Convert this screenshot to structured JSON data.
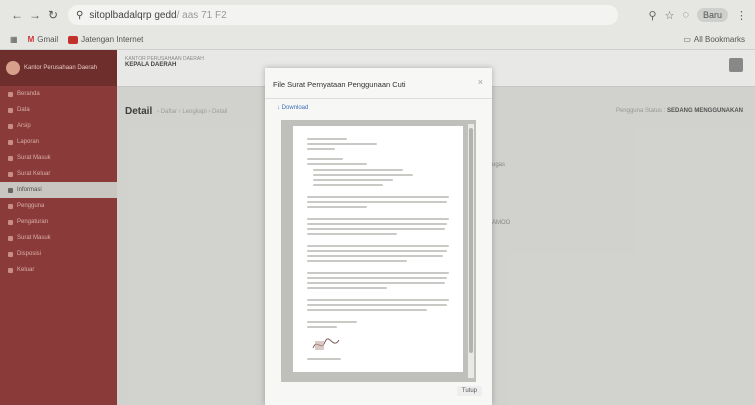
{
  "browser": {
    "url_host": "sitoplbadalqrp gedd",
    "url_rest": "/ aas 71 F2",
    "bookmarks": [
      {
        "label": "Gmail"
      },
      {
        "label": "Jatengan Internet"
      }
    ],
    "right_bookmark": "All Bookmarks",
    "profile_label": "Baru"
  },
  "sidebar": {
    "title": "Kantor Perusahaan Daerah",
    "items": [
      {
        "label": "Beranda"
      },
      {
        "label": "Data"
      },
      {
        "label": "Arsip"
      },
      {
        "label": "Laporan"
      },
      {
        "label": "Surat Masuk"
      },
      {
        "label": "Surat Keluar"
      },
      {
        "label": "Informasi"
      },
      {
        "label": "Pengguna"
      },
      {
        "label": "Pengaturan"
      },
      {
        "label": "Surat Masuk"
      },
      {
        "label": "Disposisi"
      },
      {
        "label": "Keluar"
      }
    ]
  },
  "header": {
    "org_line": "KANTOR PERUSAHAAN DAERAH",
    "org_name": "KEPALA DAERAH"
  },
  "main": {
    "title": "Detail",
    "breadcrumbs": "› Daftar  › Lengkapi  › Detail",
    "right_label_prefix": "Pengguna Status :",
    "right_label_value": "SEDANG MENGGUNAKAN",
    "bg_text_1": "ugas",
    "bg_text_2": "AMOO"
  },
  "modal": {
    "title": "File Surat Pernyataan Penggunaan Cuti",
    "download_label": "↓ Download",
    "close_label": "Tutup"
  }
}
